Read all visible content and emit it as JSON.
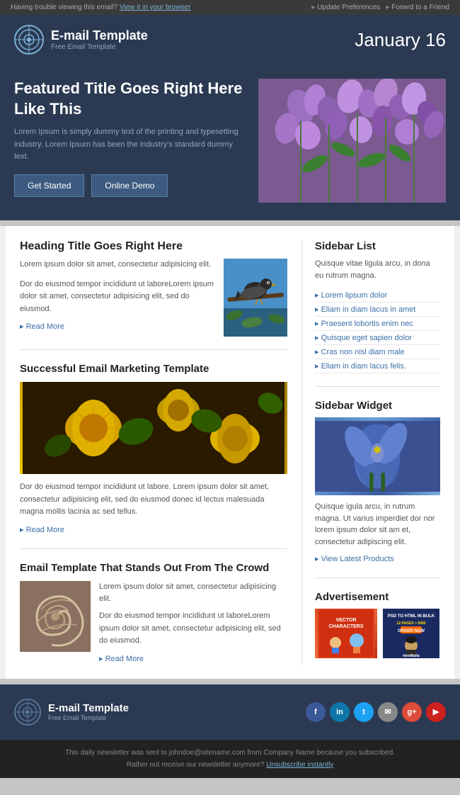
{
  "topbar": {
    "left_text": "Having trouble viewing this email?",
    "left_link": "View it in your browser",
    "right_link1": "Update Preferences",
    "right_link2": "Forwrd to a Friend"
  },
  "header": {
    "logo_title": "E-mail Template",
    "logo_subtitle": "Free Email Template",
    "date": "January 16"
  },
  "hero": {
    "title": "Featured Title Goes Right Here Like This",
    "body": "Lorem Ipsum is simply dummy text of the printing and typesetting industry. Lorem Ipsum has been the industry's standard dummy text.",
    "btn1": "Get Started",
    "btn2": "Online Demo"
  },
  "article1": {
    "heading": "Heading Title Goes Right Here",
    "intro": "Lorem ipsum dolor sit amet, consectetur adipisicing elit.",
    "body": "Dor do eiusmod tempor incididunt ut laboreLorem ipsum dolor sit amet, consectetur adipisicing elit, sed do eiusmod.",
    "read_more": "Read More"
  },
  "article2": {
    "heading": "Successful Email Marketing Template",
    "body": "Dor do eiusmod tempor incididunt ut labore. Lorem ipsum dolor sit amet, consectetur adipisicing elit, sed do eiusmod donec id lectus malesuada magna mollis lacinia ac sed tellus.",
    "read_more": "Read More"
  },
  "article3": {
    "heading": "Email Template That Stands Out From The Crowd",
    "intro": "Lorem ipsum dolor sit amet, consectetur adipisicing elit.",
    "body": "Dor do eiusmod tempor incididunt ut laboreLorem ipsum dolor sit amet, consectetur adipisicing elit, sed do eiusmod.",
    "read_more": "Read More"
  },
  "sidebar_list": {
    "heading": "Sidebar List",
    "desc": "Quisque vitae ligula arcu, in dona eu rutrum magna.",
    "items": [
      "Lorem lipsum dolor",
      "Eliam in diam lacus in amet",
      "Praesent lobortis enim nec",
      "Quisque eget sapien dolor",
      "Cras non nisl diam male",
      "Eliam in diam lacus felis."
    ]
  },
  "sidebar_widget": {
    "heading": "Sidebar Widget",
    "body": "Quisque igula arcu, in rutrum magna. Ut varius imperdiet dor nor lorem ipsum dolor sit am et, consectetur adipiscing elit.",
    "link": "View Latest Products"
  },
  "advertisement": {
    "heading": "Advertisement",
    "banner1": "VECTOR CHARACTERS",
    "banner2": "PSD TO HTML IN BULK\n12 PAGES = $490 ORDER NOW\nhtmlMafia"
  },
  "footer": {
    "logo_title": "E-mail Template",
    "logo_subtitle": "Free Email Template",
    "social": [
      "f",
      "in",
      "t",
      "✉",
      "g+",
      "▶"
    ]
  },
  "footer_bottom": {
    "text": "This daily newsletter was sent to johndoe@sitename.com from Company Name because you subscribed.",
    "text2": "Rather not receive our newsletter anymore?",
    "unsubscribe": "Unsubscribe instantly"
  }
}
